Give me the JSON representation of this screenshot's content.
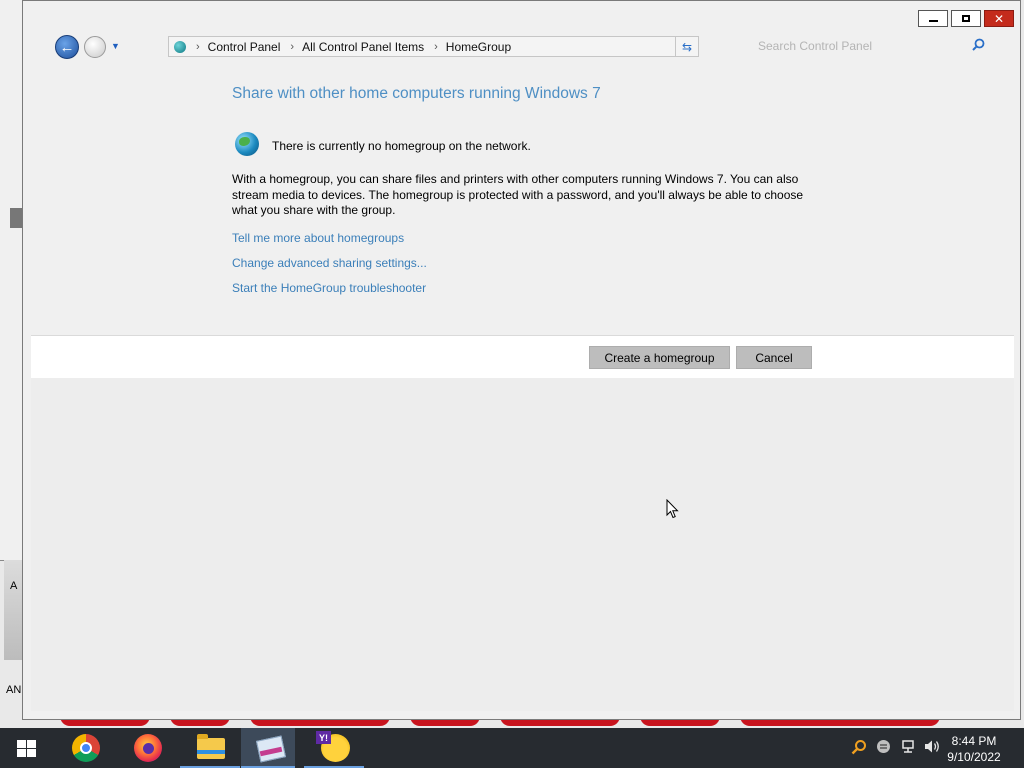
{
  "background": {
    "desktop_label_1": "A",
    "desktop_label_2": "AN"
  },
  "window": {
    "title_buttons": {
      "minimize": "",
      "maximize": "",
      "close": "✕"
    }
  },
  "nav": {
    "back_glyph": "←",
    "breadcrumbs": [
      "Control Panel",
      "All Control Panel Items",
      "HomeGroup"
    ],
    "breadcrumb_separator": "›",
    "search_placeholder": "Search Control Panel"
  },
  "content": {
    "heading": "Share with other home computers running Windows 7",
    "status": "There is currently no homegroup on the network.",
    "description": "With a homegroup, you can share files and printers with other computers running Windows 7. You can also stream media to devices. The homegroup is protected with a password, and you'll always be able to choose what you share with the group.",
    "links": [
      "Tell me more about homegroups",
      "Change advanced sharing settings...",
      "Start the HomeGroup troubleshooter"
    ]
  },
  "buttons": {
    "create": "Create a homegroup",
    "cancel": "Cancel"
  },
  "taskbar": {
    "apps": [
      "start-icon",
      "chrome-icon",
      "firefox-icon",
      "file-explorer-icon",
      "control-panel-icon",
      "yahoo-messenger-icon"
    ],
    "yahoo_badge": "Y!",
    "clock": {
      "time": "8:44 PM",
      "date": "9/10/2022"
    }
  },
  "colors": {
    "heading": "#4e8fc4",
    "link": "#3b7fb9",
    "taskbar": "#272b30",
    "close_button": "#c42b1c"
  }
}
